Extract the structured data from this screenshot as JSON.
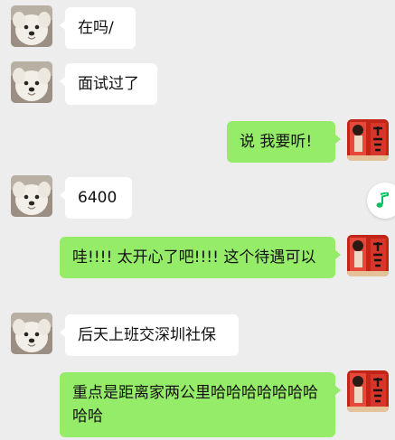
{
  "colors": {
    "background": "#ededed",
    "incoming_bubble": "#ffffff",
    "outgoing_bubble": "#95ec69",
    "music_icon": "#07c160"
  },
  "messages": [
    {
      "side": "left",
      "text": "在吗/"
    },
    {
      "side": "left",
      "text": "面试过了"
    },
    {
      "side": "right",
      "text": "说  我要听!"
    },
    {
      "side": "left",
      "text": "6400"
    },
    {
      "side": "right",
      "text": "哇!!!!  太开心了吧!!!!  这个待遇可以"
    },
    {
      "side": "left",
      "text": "后天上班交深圳社保"
    },
    {
      "side": "right",
      "text": "重点是距离家两公里哈哈哈哈哈哈哈哈哈"
    }
  ],
  "avatars": {
    "contact": "white-dog-avatar",
    "self": "red-couplet-avatar"
  },
  "floating_button": "music-note-icon"
}
